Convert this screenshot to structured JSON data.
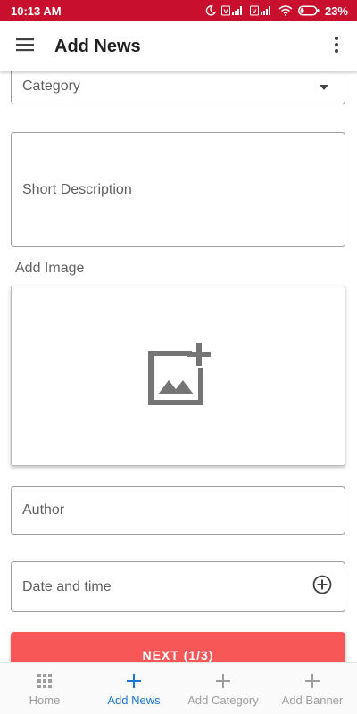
{
  "status_bar": {
    "time": "10:13 AM",
    "battery_percent": "23%",
    "battery_level": 0.23
  },
  "app_bar": {
    "title": "Add News",
    "menu_icon": "hamburger-menu-icon",
    "more_icon": "more-vert-icon"
  },
  "form": {
    "category_placeholder": "Category",
    "short_description_placeholder": "Short Description",
    "add_image_label": "Add Image",
    "image_icon": "add-photo-icon",
    "author_placeholder": "Author",
    "date_time_placeholder": "Date and time",
    "date_time_icon": "add-circle-icon",
    "next_button": "NEXT (1/3)"
  },
  "bottom_nav": {
    "items": [
      {
        "label": "Home",
        "icon": "apps-grid-icon",
        "active": false
      },
      {
        "label": "Add News",
        "icon": "plus-icon",
        "active": true
      },
      {
        "label": "Add Category",
        "icon": "plus-icon",
        "active": false
      },
      {
        "label": "Add Banner",
        "icon": "plus-icon",
        "active": false
      }
    ]
  },
  "colors": {
    "status_bar": "#c8102e",
    "next_button": "#f75757",
    "active_nav": "#1976d2",
    "inactive_nav": "#9e9e9e"
  }
}
